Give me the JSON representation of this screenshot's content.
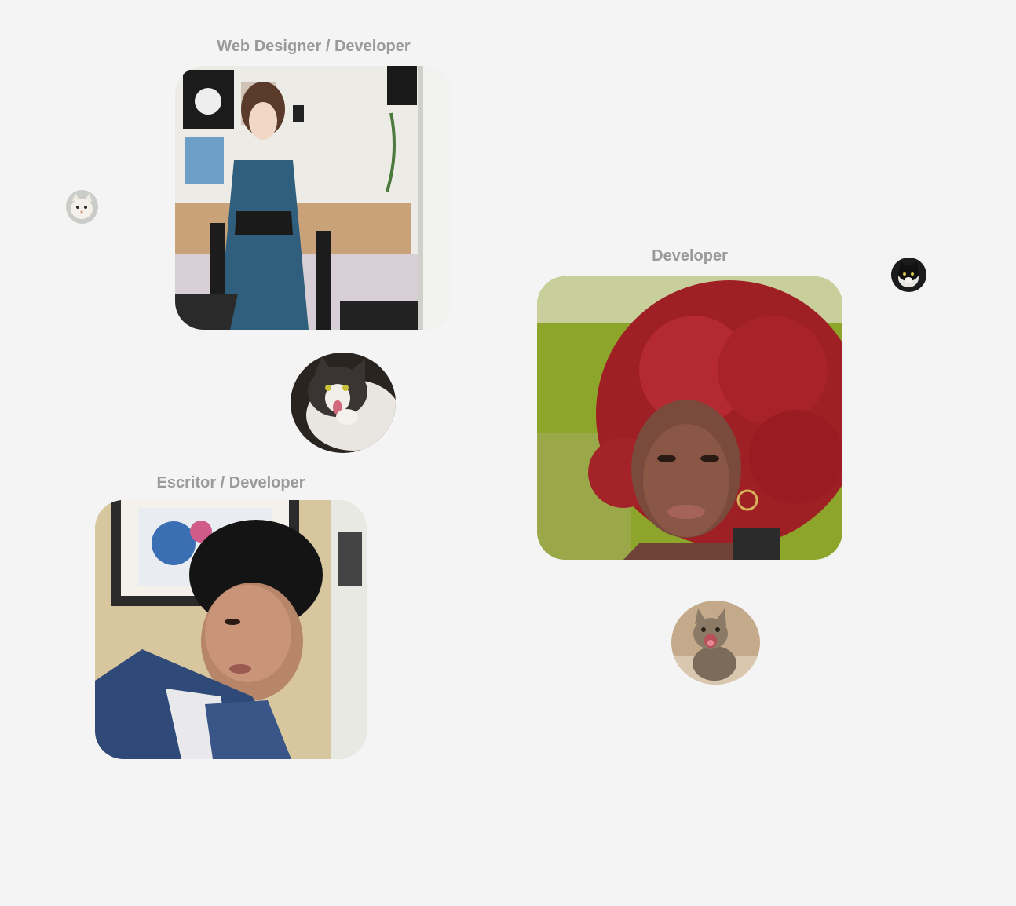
{
  "profiles": [
    {
      "role": "Web Designer / Developer"
    },
    {
      "role": "Developer"
    },
    {
      "role": "Escritor / Developer"
    }
  ],
  "colors": {
    "background": "#f4f4f4",
    "role_text": "#9a9a9a"
  }
}
